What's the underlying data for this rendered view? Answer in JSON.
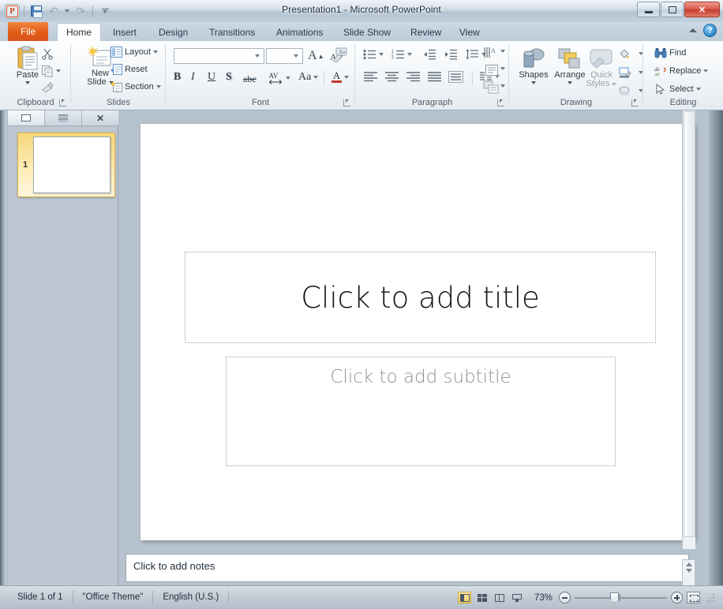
{
  "window": {
    "title": "Presentation1  -  Microsoft PowerPoint",
    "minimize_label": "Minimize",
    "maximize_label": "Restore",
    "close_label": "Close",
    "app_icon": "powerpoint-logo-icon"
  },
  "qat": {
    "save_label": "Save",
    "undo_label": "Undo",
    "redo_label": "Repeat",
    "customize_label": "Customize Quick Access Toolbar"
  },
  "tabs": [
    {
      "label": "File",
      "id": "file"
    },
    {
      "label": "Home",
      "id": "home"
    },
    {
      "label": "Insert",
      "id": "insert"
    },
    {
      "label": "Design",
      "id": "design"
    },
    {
      "label": "Transitions",
      "id": "transitions"
    },
    {
      "label": "Animations",
      "id": "animations"
    },
    {
      "label": "Slide Show",
      "id": "slide-show"
    },
    {
      "label": "Review",
      "id": "review"
    },
    {
      "label": "View",
      "id": "view"
    }
  ],
  "tab_right": {
    "minimize_ribbon_label": "Minimize the Ribbon",
    "help_label": "?"
  },
  "ribbon": {
    "groups": [
      {
        "name": "Clipboard",
        "label": "Clipboard"
      },
      {
        "name": "Slides",
        "label": "Slides"
      },
      {
        "name": "Font",
        "label": "Font"
      },
      {
        "name": "Paragraph",
        "label": "Paragraph"
      },
      {
        "name": "Drawing",
        "label": "Drawing"
      },
      {
        "name": "Editing",
        "label": "Editing"
      }
    ],
    "clipboard": {
      "paste_label": "Paste",
      "cut_label": "Cut",
      "copy_label": "Copy",
      "format_painter_label": "Format Painter"
    },
    "slides": {
      "new_slide_label": "New\nSlide",
      "new_slide_line1": "New",
      "new_slide_line2": "Slide",
      "layout_label": "Layout",
      "reset_label": "Reset",
      "section_label": "Section"
    },
    "font": {
      "font_name_value": "",
      "font_size_value": "",
      "grow_font_label": "A",
      "shrink_font_label": "A",
      "clear_formatting_label": "Clear All Formatting",
      "bold_label": "B",
      "italic_label": "I",
      "underline_label": "U",
      "shadow_label": "S",
      "strikethrough_label": "abc",
      "char_spacing_label": "AV",
      "change_case_label": "Aa",
      "font_color_label": "A"
    },
    "paragraph": {
      "bullets_label": "Bullets",
      "numbering_label": "Numbering",
      "decrease_indent_label": "Decrease List Level",
      "increase_indent_label": "Increase List Level",
      "line_spacing_label": "Line Spacing",
      "text_direction_label": "Text Direction",
      "align_text_label": "Align Text",
      "convert_smartart_label": "Convert to SmartArt",
      "align_left_label": "Align Text Left",
      "center_label": "Center",
      "align_right_label": "Align Text Right",
      "justify_label": "Justify",
      "columns_label": "Columns"
    },
    "drawing": {
      "shapes_label": "Shapes",
      "arrange_label": "Arrange",
      "quick_styles_line1": "Quick",
      "quick_styles_line2": "Styles",
      "shape_fill_label": "Shape Fill",
      "shape_outline_label": "Shape Outline",
      "shape_effects_label": "Shape Effects"
    },
    "editing": {
      "find_label": "Find",
      "replace_label": "Replace",
      "select_label": "Select"
    }
  },
  "slides_pane": {
    "slides_tab_label": "Slides",
    "outline_tab_label": "Outline",
    "close_label": "✕",
    "thumbnail_number": "1"
  },
  "slide": {
    "title_placeholder": "Click to add title",
    "subtitle_placeholder": "Click to add subtitle"
  },
  "notes": {
    "placeholder": "Click to add notes"
  },
  "status_bar": {
    "slide_count": "Slide 1 of 1",
    "theme": "\"Office Theme\"",
    "language": "English (U.S.)",
    "zoom_percent": "73%",
    "views": [
      {
        "name": "normal-view",
        "label": "Normal"
      },
      {
        "name": "slide-sorter-view",
        "label": "Slide Sorter"
      },
      {
        "name": "reading-view",
        "label": "Reading View"
      },
      {
        "name": "slide-show-view",
        "label": "Slide Show"
      }
    ],
    "zoom_out_label": "Zoom Out",
    "zoom_in_label": "Zoom In",
    "fit_label": "Fit slide to current window"
  },
  "colors": {
    "accent_orange": "#d9541e",
    "titlebar": "#c8d5e1",
    "ribbon_bg": "#f1f4f7",
    "workspace": "#b6c2cd",
    "thumb_highlight": "#f7d77a",
    "close_red": "#c33b2c"
  }
}
